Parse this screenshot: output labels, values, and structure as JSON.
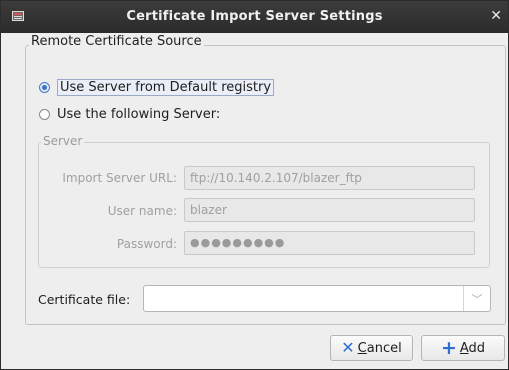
{
  "window": {
    "title": "Certificate Import Server Settings"
  },
  "source_group": {
    "legend": "Remote Certificate Source",
    "option_default": "Use Server from Default registry",
    "option_following": "Use the following Server:",
    "selected": "default"
  },
  "server_group": {
    "legend": "Server",
    "url_label": "Import Server URL:",
    "url_value": "ftp://10.140.2.107/blazer_ftp",
    "user_label": "User name:",
    "user_value": "blazer",
    "password_label": "Password:",
    "password_mask": "●●●●●●●●●"
  },
  "certificate": {
    "label": "Certificate file:",
    "value": ""
  },
  "buttons": {
    "cancel_mnemonic": "C",
    "cancel_rest": "ancel",
    "add_mnemonic": "A",
    "add_rest": "dd"
  },
  "icons": {
    "app": "app-icon",
    "close": "close-icon",
    "cancel": "x-icon",
    "add": "plus-icon",
    "dropdown": "chevron-down-icon"
  },
  "colors": {
    "accent": "#2f6fd1",
    "titlebar": "#333333"
  }
}
